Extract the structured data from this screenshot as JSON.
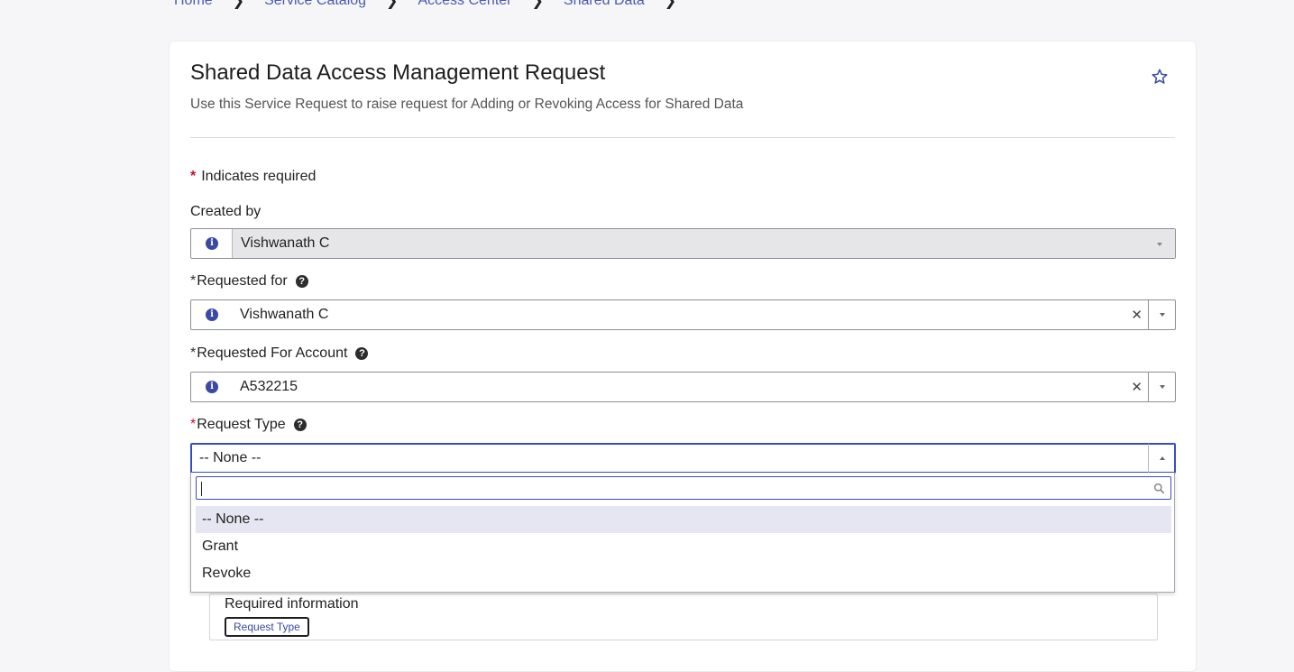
{
  "breadcrumb": [
    "Home",
    "Service Catalog",
    "Access Center",
    "Shared Data"
  ],
  "form": {
    "title": "Shared Data Access Management Request",
    "subtitle": "Use this Service Request to raise request for Adding or Revoking Access for Shared Data",
    "required_note": "Indicates required",
    "created_by": {
      "label": "Created by",
      "value": "Vishwanath C"
    },
    "requested_for": {
      "label": "Requested for",
      "value": "Vishwanath C"
    },
    "requested_for_account": {
      "label": "Requested For Account",
      "value": "A532215"
    },
    "request_type": {
      "label": "Request Type",
      "value": "-- None --",
      "search_value": "",
      "options": [
        "-- None --",
        "Grant",
        "Revoke"
      ]
    },
    "required_info": {
      "title": "Required information",
      "pill": "Request Type"
    }
  },
  "colors": {
    "accent": "#3b4cc0",
    "required": "#c8102e",
    "link": "#4a5ab0"
  }
}
